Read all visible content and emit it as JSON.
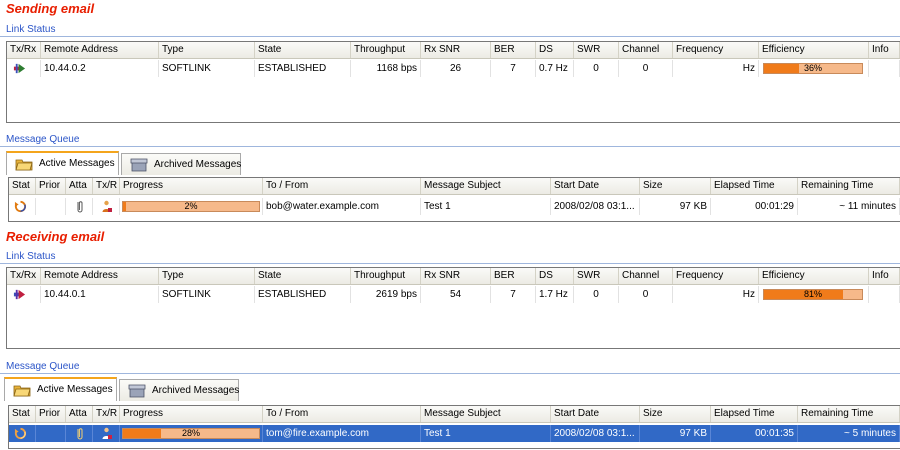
{
  "colors": {
    "heading": "#e81e00",
    "group_label": "#2b55c8",
    "progress_fill": "#f07b1a",
    "progress_track": "#f6b98a",
    "selection": "#3169c6"
  },
  "sending": {
    "heading": "Sending email",
    "link_status_label": "Link Status",
    "link_columns": [
      "Tx/Rx",
      "Remote Address",
      "Type",
      "State",
      "Throughput",
      "Rx SNR",
      "BER",
      "DS",
      "SWR",
      "Channel",
      "Frequency",
      "Efficiency",
      "Info"
    ],
    "link_row": {
      "direction_icon": "send-arrow-icon",
      "remote_address": "10.44.0.2",
      "type": "SOFTLINK",
      "state": "ESTABLISHED",
      "throughput": "1168 bps",
      "rx_snr": "26",
      "ber": "7",
      "ds": "0.7 Hz",
      "swr": "0",
      "channel": "0",
      "frequency_unit": "Hz",
      "efficiency_text": "36%",
      "efficiency": 0.36
    },
    "queue_label": "Message Queue",
    "tabs": [
      {
        "label": "Active Messages",
        "icon": "folder-open-icon"
      },
      {
        "label": "Archived Messages",
        "icon": "archive-icon"
      }
    ],
    "msg_columns": [
      "Stat",
      "Prior",
      "Atta",
      "Tx/R",
      "Progress",
      "To / From",
      "Message Subject",
      "Start Date",
      "Size",
      "Elapsed Time",
      "Remaining Time"
    ],
    "msg_row": {
      "status_icon": "sync-icon",
      "attach_icon": "paperclip-icon",
      "tx_icon": "person-upload-icon",
      "progress_text": "2%",
      "progress": 0.02,
      "to_from": "bob@water.example.com",
      "subject": "Test 1",
      "start_date": "2008/02/08 03:1...",
      "size": "97 KB",
      "elapsed": "00:01:29",
      "remaining": "~ 11 minutes"
    }
  },
  "receiving": {
    "heading": "Receiving email",
    "link_status_label": "Link Status",
    "link_columns": [
      "Tx/Rx",
      "Remote Address",
      "Type",
      "State",
      "Throughput",
      "Rx SNR",
      "BER",
      "DS",
      "SWR",
      "Channel",
      "Frequency",
      "Efficiency",
      "Info"
    ],
    "link_row": {
      "direction_icon": "receive-arrow-icon",
      "remote_address": "10.44.0.1",
      "type": "SOFTLINK",
      "state": "ESTABLISHED",
      "throughput": "2619 bps",
      "rx_snr": "54",
      "ber": "7",
      "ds": "1.7 Hz",
      "swr": "0",
      "channel": "0",
      "frequency_unit": "Hz",
      "efficiency_text": "81%",
      "efficiency": 0.81
    },
    "queue_label": "Message Queue",
    "tabs": [
      {
        "label": "Active Messages",
        "icon": "folder-open-icon"
      },
      {
        "label": "Archived Messages",
        "icon": "archive-icon"
      }
    ],
    "msg_columns": [
      "Stat",
      "Prior",
      "Atta",
      "Tx/R",
      "Progress",
      "To / From",
      "Message Subject",
      "Start Date",
      "Size",
      "Elapsed Time",
      "Remaining Time"
    ],
    "msg_row": {
      "status_icon": "sync-icon",
      "attach_icon": "paperclip-icon",
      "tx_icon": "person-download-icon",
      "progress_text": "28%",
      "progress": 0.28,
      "to_from": "tom@fire.example.com",
      "subject": "Test 1",
      "start_date": "2008/02/08 03:1...",
      "size": "97 KB",
      "elapsed": "00:01:35",
      "remaining": "~ 5 minutes"
    }
  }
}
